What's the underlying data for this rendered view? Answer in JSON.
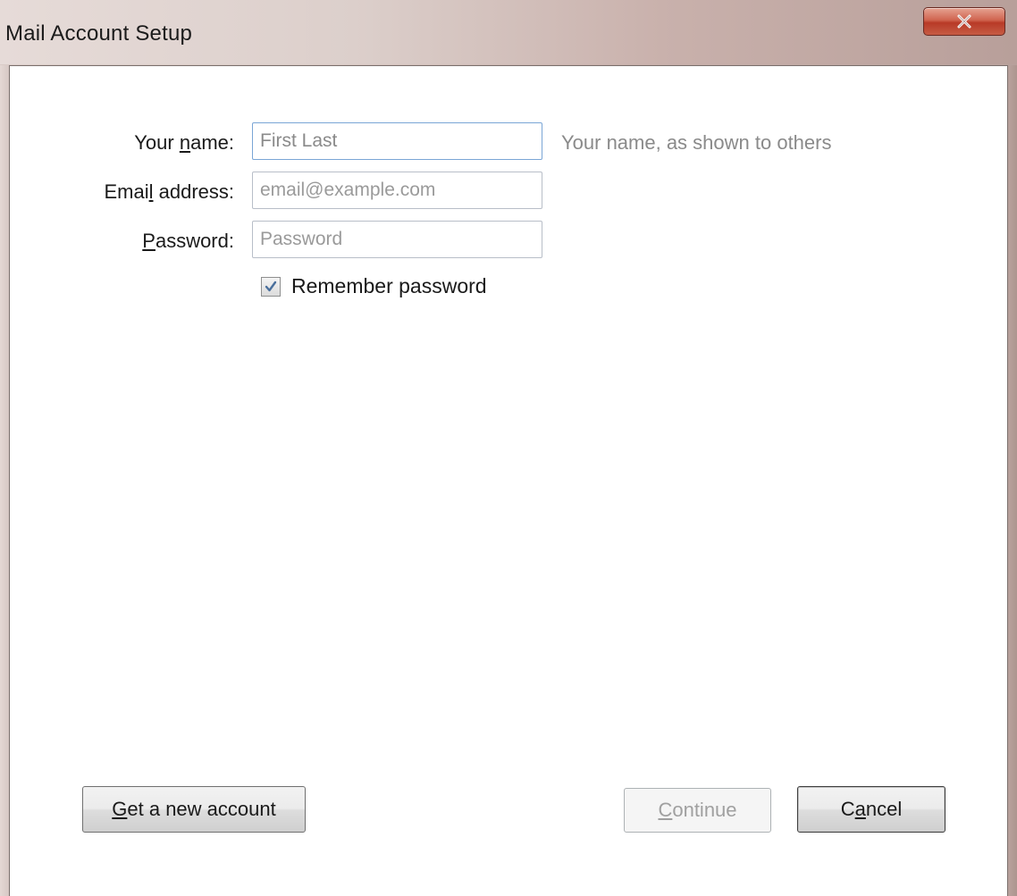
{
  "window": {
    "title": "Mail Account Setup"
  },
  "form": {
    "name": {
      "label_pre": "Your ",
      "label_key": "n",
      "label_post": "ame:",
      "placeholder": "First Last",
      "value": ""
    },
    "email": {
      "label_pre": "Emai",
      "label_key": "l",
      "label_post": " address:",
      "placeholder": "email@example.com",
      "value": ""
    },
    "password": {
      "label_pre": "",
      "label_key": "P",
      "label_post": "assword:",
      "placeholder": "Password",
      "value": ""
    },
    "name_hint": "Your name, as shown to others",
    "remember": {
      "label": "Remember password",
      "checked": true
    }
  },
  "buttons": {
    "get_account": {
      "key": "G",
      "rest": "et a new account"
    },
    "continue": {
      "key": "C",
      "rest": "ontinue",
      "enabled": false
    },
    "cancel": {
      "pre": "C",
      "key": "a",
      "rest": "ncel"
    }
  },
  "colors": {
    "close_button": "#c64a34",
    "focus_border": "#7aa6d6",
    "hint_text": "#8a8a8a"
  },
  "icons": {
    "close": "close-icon",
    "check": "checkmark-icon"
  }
}
